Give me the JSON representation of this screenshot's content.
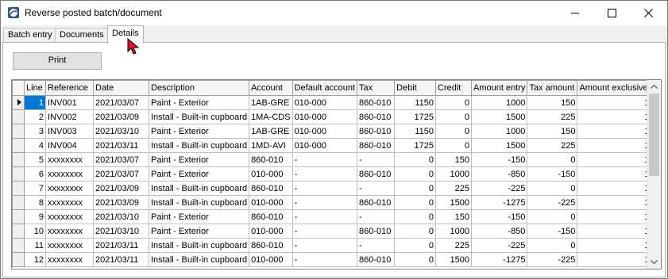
{
  "window": {
    "title": "Reverse posted batch/document"
  },
  "tabs": [
    "Batch entry",
    "Documents",
    "Details"
  ],
  "toolbar": {
    "print_label": "Print"
  },
  "grid": {
    "columns": [
      "Line",
      "Reference",
      "Date",
      "Description",
      "Account",
      "Default account",
      "Tax",
      "Debit",
      "Credit",
      "Amount entry",
      "Tax amount",
      "Amount exclusive"
    ],
    "rows": [
      [
        "1",
        "INV001",
        "2021/03/07",
        "Paint - Exterior",
        "1AB-GRE",
        "010-000",
        "860-010",
        "1150",
        "0",
        "1000",
        "150",
        "1"
      ],
      [
        "2",
        "INV002",
        "2021/03/09",
        "Install - Built-in cupboard",
        "1MA-CDS",
        "010-000",
        "860-010",
        "1725",
        "0",
        "1500",
        "225",
        "1"
      ],
      [
        "3",
        "INV003",
        "2021/03/10",
        "Paint - Exterior",
        "1AB-GRE",
        "010-000",
        "860-010",
        "1150",
        "0",
        "1000",
        "150",
        "1"
      ],
      [
        "4",
        "INV004",
        "2021/03/11",
        "Install - Built-in cupboard",
        "1MD-AVI",
        "010-000",
        "860-010",
        "1725",
        "0",
        "1500",
        "225",
        "1"
      ],
      [
        "5",
        "xxxxxxxx",
        "2021/03/07",
        "Paint - Exterior",
        "860-010",
        "-",
        "-",
        "0",
        "150",
        "-150",
        "0",
        "1"
      ],
      [
        "6",
        "xxxxxxxx",
        "2021/03/07",
        "Paint - Exterior",
        "010-000",
        "-",
        "860-010",
        "0",
        "1000",
        "-850",
        "-150",
        "1"
      ],
      [
        "7",
        "xxxxxxxx",
        "2021/03/09",
        "Install - Built-in cupboard",
        "860-010",
        "-",
        "-",
        "0",
        "225",
        "-225",
        "0",
        "1"
      ],
      [
        "8",
        "xxxxxxxx",
        "2021/03/09",
        "Install - Built-in cupboard",
        "010-000",
        "-",
        "860-010",
        "0",
        "1500",
        "-1275",
        "-225",
        "1"
      ],
      [
        "9",
        "xxxxxxxx",
        "2021/03/10",
        "Paint - Exterior",
        "860-010",
        "-",
        "-",
        "0",
        "150",
        "-150",
        "0",
        "1"
      ],
      [
        "10",
        "xxxxxxxx",
        "2021/03/10",
        "Paint - Exterior",
        "010-000",
        "-",
        "860-010",
        "0",
        "1000",
        "-850",
        "-150",
        "1"
      ],
      [
        "11",
        "xxxxxxxx",
        "2021/03/11",
        "Install - Built-in cupboard",
        "860-010",
        "-",
        "-",
        "0",
        "225",
        "-225",
        "0",
        "1"
      ],
      [
        "12",
        "xxxxxxxx",
        "2021/03/11",
        "Install - Built-in cupboard",
        "010-000",
        "-",
        "860-010",
        "0",
        "1500",
        "-1275",
        "-225",
        "1"
      ]
    ]
  },
  "colors": {
    "selection": "#0078d7",
    "window_bg": "#f0f0f0",
    "cursor": "#e81123"
  }
}
